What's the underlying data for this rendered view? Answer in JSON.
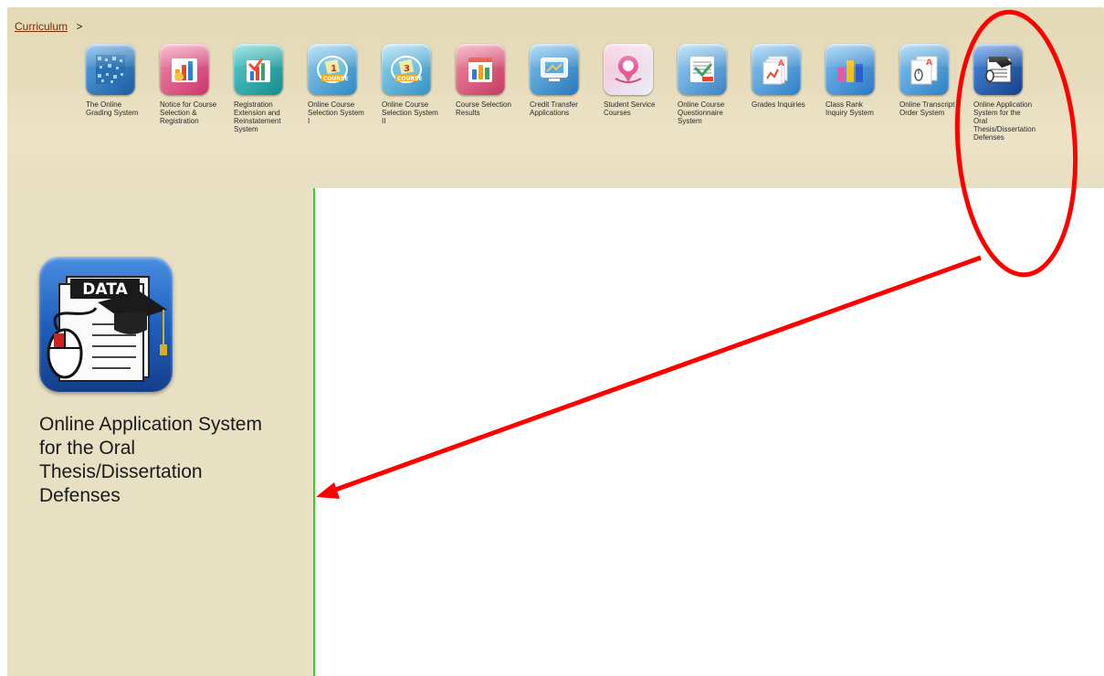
{
  "breadcrumb": {
    "root": "Curriculum",
    "separator": ">"
  },
  "apps": [
    {
      "label": "The Online Grading System",
      "icon": "grading-icon",
      "color": "#1f6fb8"
    },
    {
      "label": "Notice for Course Selection & Registration",
      "icon": "notice-icon",
      "color": "#d9534f"
    },
    {
      "label": "Registration Extension and Reinstatement System",
      "icon": "registration-icon",
      "color": "#1f9a9a"
    },
    {
      "label": "Online Course Selection System I",
      "icon": "course-selection-1-icon",
      "color": "#3a8fc6"
    },
    {
      "label": "Online Course Selection System II",
      "icon": "course-selection-2-icon",
      "color": "#3aa0c8"
    },
    {
      "label": "Course Selection Results",
      "icon": "results-icon",
      "color": "#c94a6e"
    },
    {
      "label": "Credit Transfer Applications",
      "icon": "credit-transfer-icon",
      "color": "#2a7fc0"
    },
    {
      "label": "Student Service Courses",
      "icon": "student-service-icon",
      "color": "#d84a8a"
    },
    {
      "label": "Online Course Questionnaire System",
      "icon": "questionnaire-icon",
      "color": "#3a7fc6"
    },
    {
      "label": "Grades Inquiries",
      "icon": "grades-icon",
      "color": "#2f83c9"
    },
    {
      "label": "Class Rank Inquiry System",
      "icon": "class-rank-icon",
      "color": "#2a7ec8"
    },
    {
      "label": "Online Transcript Order System",
      "icon": "transcript-icon",
      "color": "#2d86c6"
    },
    {
      "label": "Online Application System for the Oral Thesis/Dissertation Defenses",
      "icon": "thesis-defense-icon",
      "color": "#1f5fbf"
    }
  ],
  "selected": {
    "icon_text": "DATA",
    "label": "Online Application System for the Oral Thesis/Dissertation Defenses"
  },
  "colors": {
    "panel_bg": "#e8e0c3",
    "divider": "#2fd22f",
    "annotation": "#ff0000",
    "breadcrumb_link": "#7b2c00"
  }
}
